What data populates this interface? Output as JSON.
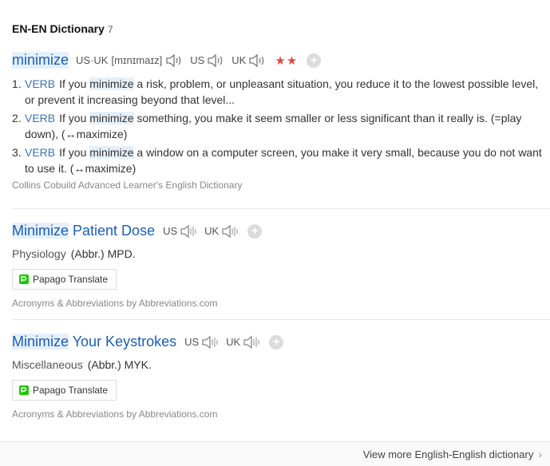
{
  "header": {
    "title": "EN-EN Dictionary",
    "count": "7"
  },
  "entry1": {
    "word": "minimize",
    "pron_label": "US·UK",
    "ipa": "[mɪnɪmaɪz]",
    "us_label": "US",
    "uk_label": "UK",
    "stars": "★★",
    "definitions": [
      {
        "num": "1.",
        "pos": "VERB",
        "pre": "If you ",
        "hl": "minimize",
        "post": " a risk, problem, or unpleasant situation, you reduce it to the lowest possible level, or prevent it increasing beyond that level..."
      },
      {
        "num": "2.",
        "pos": "VERB",
        "pre": "If you ",
        "hl": "minimize",
        "post": " something, you make it seem smaller or less significant than it really is. (=play down), (↔maximize)"
      },
      {
        "num": "3.",
        "pos": "VERB",
        "pre": "If you ",
        "hl": "minimize",
        "post": " a window on a computer screen, you make it very small, because you do not want to use it. (↔maximize)"
      }
    ],
    "source": "Collins Cobuild Advanced Learner's English Dictionary"
  },
  "entry2": {
    "word_hl": "Minimize",
    "word_rest": " Patient Dose",
    "us_label": "US",
    "uk_label": "UK",
    "subject": "Physiology",
    "abbr": "(Abbr.) MPD.",
    "translate": "Papago Translate",
    "source": "Acronyms & Abbreviations by Abbreviations.com"
  },
  "entry3": {
    "word_hl": "Minimize",
    "word_rest": " Your Keystrokes",
    "us_label": "US",
    "uk_label": "UK",
    "subject": "Miscellaneous",
    "abbr": "(Abbr.) MYK.",
    "translate": "Papago Translate",
    "source": "Acronyms & Abbreviations by Abbreviations.com"
  },
  "footer": {
    "more_label": "View more English-English dictionary",
    "chevron": "›"
  },
  "colors": {
    "headword": "#1a5fb4",
    "pos": "#3a73b5",
    "star": "#e04a3f",
    "highlight": "#e6f0fb"
  },
  "icons": [
    "speaker-icon",
    "speaker-muted-icon",
    "plus-icon",
    "papago-icon",
    "chevron-right-icon"
  ]
}
